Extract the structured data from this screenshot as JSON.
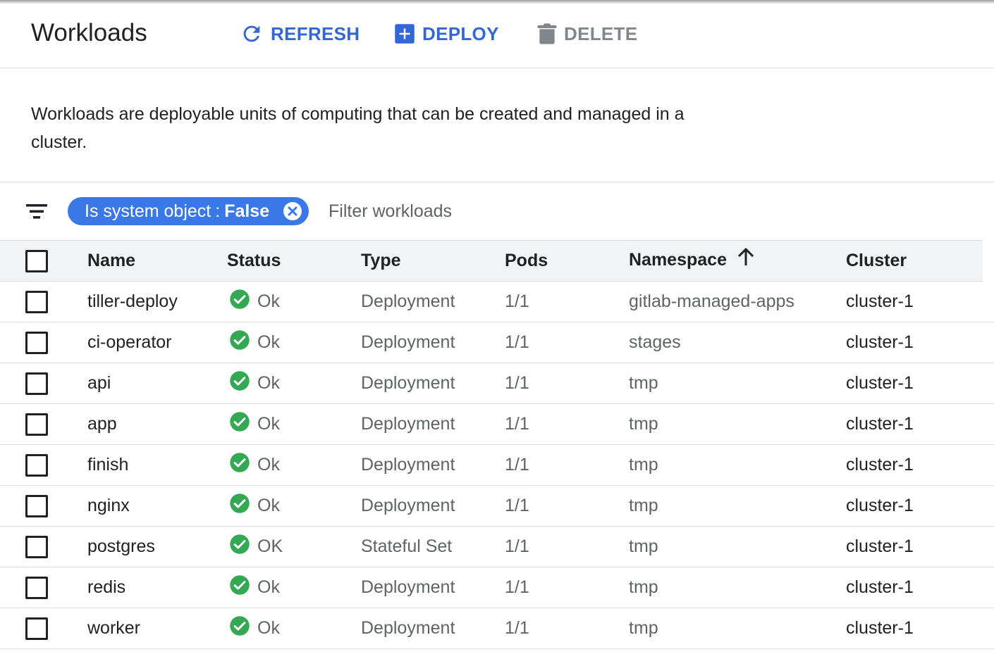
{
  "header": {
    "title": "Workloads",
    "buttons": {
      "refresh": {
        "label": "REFRESH",
        "icon": "refresh-icon"
      },
      "deploy": {
        "label": "DEPLOY",
        "icon": "add-box-icon"
      },
      "delete": {
        "label": "DELETE",
        "icon": "trash-icon"
      }
    }
  },
  "description": "Workloads are deployable units of computing that can be created and managed in a cluster.",
  "filter": {
    "icon": "filter-list-icon",
    "chip": {
      "key": "Is system object",
      "separator": ":",
      "value": "False",
      "close_icon": "cancel-icon"
    },
    "placeholder": "Filter workloads"
  },
  "colors": {
    "accent": "#3367d6",
    "chip_background": "#3b78e7",
    "status_ok": "#34a853",
    "disabled": "#80868b"
  },
  "table": {
    "columns": {
      "name": "Name",
      "status": "Status",
      "type": "Type",
      "pods": "Pods",
      "namespace": "Namespace",
      "cluster": "Cluster"
    },
    "sort": {
      "column": "namespace",
      "direction": "ascending",
      "icon": "arrow-upward-icon"
    },
    "rows": [
      {
        "name": "tiller-deploy",
        "status": "Ok",
        "type": "Deployment",
        "pods": "1/1",
        "namespace": "gitlab-managed-apps",
        "cluster": "cluster-1"
      },
      {
        "name": "ci-operator",
        "status": "Ok",
        "type": "Deployment",
        "pods": "1/1",
        "namespace": "stages",
        "cluster": "cluster-1"
      },
      {
        "name": "api",
        "status": "Ok",
        "type": "Deployment",
        "pods": "1/1",
        "namespace": "tmp",
        "cluster": "cluster-1"
      },
      {
        "name": "app",
        "status": "Ok",
        "type": "Deployment",
        "pods": "1/1",
        "namespace": "tmp",
        "cluster": "cluster-1"
      },
      {
        "name": "finish",
        "status": "Ok",
        "type": "Deployment",
        "pods": "1/1",
        "namespace": "tmp",
        "cluster": "cluster-1"
      },
      {
        "name": "nginx",
        "status": "Ok",
        "type": "Deployment",
        "pods": "1/1",
        "namespace": "tmp",
        "cluster": "cluster-1"
      },
      {
        "name": "postgres",
        "status": "OK",
        "type": "Stateful Set",
        "pods": "1/1",
        "namespace": "tmp",
        "cluster": "cluster-1"
      },
      {
        "name": "redis",
        "status": "Ok",
        "type": "Deployment",
        "pods": "1/1",
        "namespace": "tmp",
        "cluster": "cluster-1"
      },
      {
        "name": "worker",
        "status": "Ok",
        "type": "Deployment",
        "pods": "1/1",
        "namespace": "tmp",
        "cluster": "cluster-1"
      }
    ]
  }
}
